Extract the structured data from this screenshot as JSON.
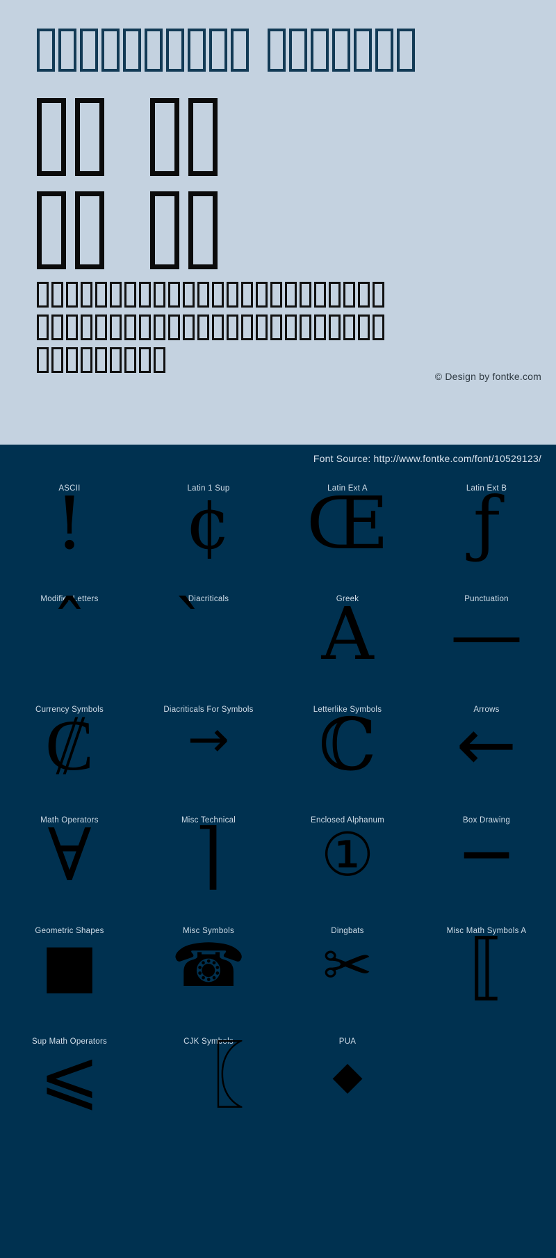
{
  "colors": {
    "specimen_background": "#c4d2e0",
    "coverage_background": "#003150",
    "glyph": "#000000",
    "label": "#cfdde8",
    "title_box": "#123a55"
  },
  "specimen": {
    "title_line": {
      "tofu_groups": [
        10,
        7
      ]
    },
    "big_line_1": {
      "tofu_groups": [
        2,
        2
      ]
    },
    "big_line_2": {
      "tofu_groups": [
        2,
        2
      ]
    },
    "paragraph_lines": [
      24,
      24,
      9
    ],
    "copyright": "© Design by fontke.com"
  },
  "coverage": {
    "font_source": "Font Source: http://www.fontke.com/font/10529123/",
    "rows": [
      [
        {
          "label": "ASCII",
          "glyph": "!",
          "style": "serif",
          "size": "g-xl",
          "nudge": "nudge-up"
        },
        {
          "label": "Latin 1 Sup",
          "glyph": "¢",
          "style": "serif",
          "size": "g-xl",
          "nudge": "nudge-up"
        },
        {
          "label": "Latin Ext A",
          "glyph": "Œ",
          "style": "serif",
          "size": "g-xl",
          "nudge": "nudge-up"
        },
        {
          "label": "Latin Ext B",
          "glyph": "ƒ",
          "style": "serif",
          "size": "g-xl",
          "nudge": "nudge-up"
        }
      ],
      [
        {
          "label": "Modifier Letters",
          "glyph": "ˆ",
          "style": "serif",
          "size": "g-xl",
          "nudge": "nudge-up2"
        },
        {
          "label": "Diacriticals",
          "glyph": "̀",
          "style": "serif",
          "size": "g-xl",
          "nudge": "nudge-up2"
        },
        {
          "label": "Greek",
          "glyph": "Α",
          "style": "serif",
          "size": "g-xl",
          "nudge": "nudge-up"
        },
        {
          "label": "Punctuation",
          "glyph": "—",
          "style": "serif",
          "size": "g-xl",
          "nudge": "nudge-up"
        }
      ],
      [
        {
          "label": "Currency Symbols",
          "glyph": "₡",
          "style": "serif",
          "size": "g-xl",
          "nudge": "nudge-up"
        },
        {
          "label": "Diacriticals For Symbols",
          "glyph": "→",
          "style": "sans",
          "size": "g-md",
          "nudge": "nudge-up2"
        },
        {
          "label": "Letterlike Symbols",
          "glyph": "ℂ",
          "style": "serif",
          "size": "g-xl",
          "nudge": "nudge-up"
        },
        {
          "label": "Arrows",
          "glyph": "←",
          "style": "sans",
          "size": "g-xl",
          "nudge": "nudge-up"
        }
      ],
      [
        {
          "label": "Math Operators",
          "glyph": "∀",
          "style": "serif",
          "size": "g-xl",
          "nudge": "nudge-up"
        },
        {
          "label": "Misc Technical",
          "glyph": "⌉",
          "style": "serif",
          "size": "g-xl",
          "nudge": "nudge-up"
        },
        {
          "label": "Enclosed Alphanum",
          "glyph": "①",
          "style": "sans",
          "size": "g-lg",
          "nudge": "nudge-up"
        },
        {
          "label": "Box Drawing",
          "glyph": "─",
          "style": "sans",
          "size": "g-xl",
          "nudge": "nudge-up"
        }
      ],
      [
        {
          "label": "Geometric Shapes",
          "glyph": "■",
          "style": "sans",
          "size": "g-lg",
          "nudge": "nudge-up"
        },
        {
          "label": "Misc Symbols",
          "glyph": "☎",
          "style": "sans",
          "size": "g-lg",
          "nudge": "nudge-up"
        },
        {
          "label": "Dingbats",
          "glyph": "✂",
          "style": "sans",
          "size": "g-lg",
          "nudge": "nudge-up"
        },
        {
          "label": "Misc Math Symbols A",
          "glyph": "⟦",
          "style": "serif",
          "size": "g-xl",
          "nudge": "nudge-up"
        }
      ],
      [
        {
          "label": "Sup Math Operators",
          "glyph": "⩽",
          "style": "serif",
          "size": "g-xl",
          "nudge": "nudge-up"
        },
        {
          "label": "CJK Symbols",
          "glyph": "〖",
          "style": "serif",
          "size": "g-xl",
          "nudge": "nudge-up"
        },
        {
          "label": "PUA",
          "glyph": "◆",
          "style": "sans",
          "size": "g-sm",
          "nudge": "nudge-up"
        },
        {
          "label": "",
          "glyph": "",
          "style": "sans",
          "size": "g-sm",
          "nudge": ""
        }
      ]
    ]
  }
}
